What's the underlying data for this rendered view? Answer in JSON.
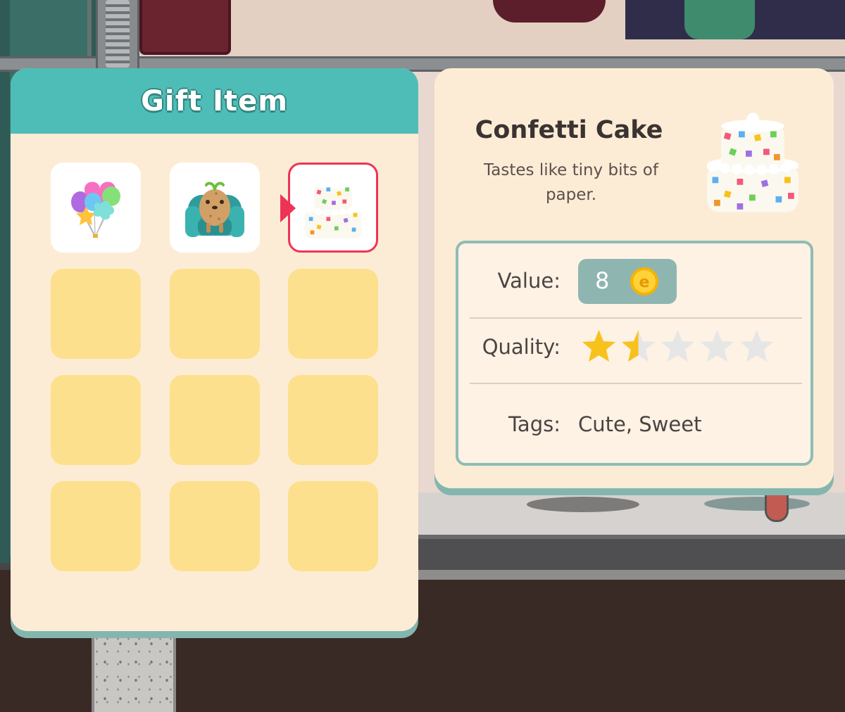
{
  "gift_panel": {
    "title": "Gift Item",
    "slots": [
      {
        "item": "balloons-icon",
        "filled": true,
        "selected": false
      },
      {
        "item": "potato-armchair-icon",
        "filled": true,
        "selected": false
      },
      {
        "item": "confetti-cake-icon",
        "filled": true,
        "selected": true
      },
      {
        "filled": false
      },
      {
        "filled": false
      },
      {
        "filled": false
      },
      {
        "filled": false
      },
      {
        "filled": false
      },
      {
        "filled": false
      },
      {
        "filled": false
      },
      {
        "filled": false
      },
      {
        "filled": false
      }
    ]
  },
  "detail": {
    "name": "Confetti Cake",
    "description": "Tastes like tiny bits of paper.",
    "value_label": "Value:",
    "value": "8",
    "currency_icon": "coin-icon",
    "quality_label": "Quality:",
    "quality_stars": 1.5,
    "quality_max": 5,
    "tags_label": "Tags:",
    "tags": "Cute, Sweet"
  },
  "colors": {
    "header": "#4fbdb7",
    "panel": "#fdecd5",
    "empty_slot": "#fde08e",
    "selection": "#ee3358",
    "star_gold": "#f8c21c",
    "star_empty": "#e6e6e6"
  }
}
